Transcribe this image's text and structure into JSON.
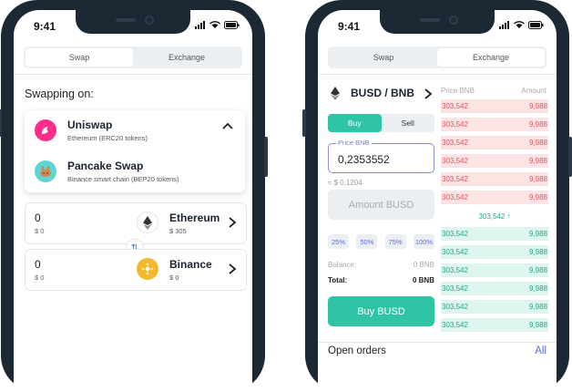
{
  "status_time": "9:41",
  "tabs": {
    "swap": "Swap",
    "exchange": "Exchange"
  },
  "swap_screen": {
    "heading": "Swapping on:",
    "dexes": [
      {
        "name": "Uniswap",
        "subtitle": "Ethereum (ERC20 tokens)"
      },
      {
        "name": "Pancake Swap",
        "subtitle": "Binance smart chain (BEP20 tokens)"
      }
    ],
    "from": {
      "amount": "0",
      "usd": "$ 0",
      "token": "Ethereum",
      "token_usd": "$ 305"
    },
    "to": {
      "amount": "0",
      "usd": "$ 0",
      "token": "Binance",
      "token_usd": "$ 0"
    }
  },
  "exchange_screen": {
    "pair": "BUSD / BNB",
    "orderbook_header": {
      "price": "Price BNB",
      "amount": "Amount"
    },
    "buy_label": "Buy",
    "sell_label": "Sell",
    "price_label": "Price BNB",
    "price_value": "0,2353552",
    "approx": "≈ $ 0,1204",
    "amount_placeholder": "Amount BUSD",
    "percents": [
      "25%",
      "50%",
      "75%",
      "100%"
    ],
    "balance_label": "Balance:",
    "balance_value": "0 BNB",
    "total_label": "Total:",
    "total_value": "0 BNB",
    "buy_button": "Buy BUSD",
    "sell_orders": [
      {
        "price": "303,542",
        "amount": "9,988"
      },
      {
        "price": "303,542",
        "amount": "9,988"
      },
      {
        "price": "303,542",
        "amount": "9,988"
      },
      {
        "price": "303,542",
        "amount": "9,988"
      },
      {
        "price": "303,542",
        "amount": "9,988"
      },
      {
        "price": "303,542",
        "amount": "9,988"
      }
    ],
    "mid_price": "303,542 ↑",
    "buy_orders": [
      {
        "price": "303,542",
        "amount": "9,988"
      },
      {
        "price": "303,542",
        "amount": "9,988"
      },
      {
        "price": "303,542",
        "amount": "9,988"
      },
      {
        "price": "303,542",
        "amount": "9,988"
      },
      {
        "price": "303,542",
        "amount": "9,988"
      },
      {
        "price": "303,542",
        "amount": "9,988"
      }
    ],
    "open_orders_title": "Open orders",
    "open_orders_all": "All"
  },
  "colors": {
    "accent": "#2ec4a5",
    "sell": "#e05560",
    "buy": "#24a889",
    "link": "#5a6ad8",
    "frame": "#1c2833"
  }
}
